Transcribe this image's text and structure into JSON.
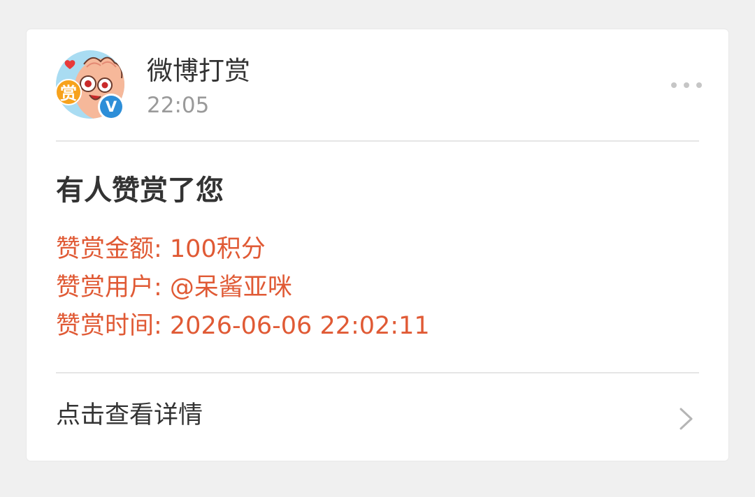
{
  "sender": {
    "name": "微博打赏",
    "time": "22:05",
    "avatar_icon": "reward-mascot-avatar",
    "avatar_badge_text": "赏",
    "verified_mark": "V"
  },
  "message": {
    "title": "有人赞赏了您",
    "details": [
      "赞赏金额: 100积分",
      "赞赏用户: @呆酱亚咪",
      "赞赏时间: 2026-06-06 22:02:11"
    ]
  },
  "footer": {
    "label": "点击查看详情"
  },
  "colors": {
    "detail_text": "#e05a35",
    "verified_badge": "#2d8ed8",
    "background": "#f0f0f0"
  },
  "icons": {
    "more": "more-dots-icon",
    "chevron": "chevron-right-icon",
    "verified": "verified-badge-icon"
  }
}
